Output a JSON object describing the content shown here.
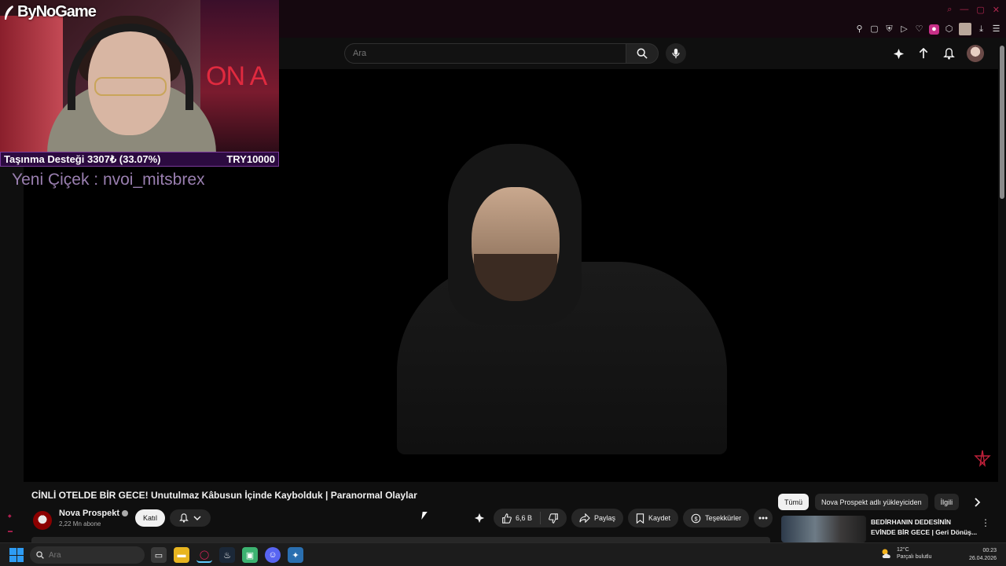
{
  "overlay": {
    "logo_text": "ByNoGame",
    "support_label": "Taşınma Desteği 3307₺ (33.07%)",
    "support_goal": "TRY10000",
    "support_progress_percent": 33.07,
    "new_flower": "Yeni Çiçek : nvoi_mitsbrex",
    "poster_text": "ON A"
  },
  "header": {
    "search_placeholder": "Ara"
  },
  "video": {
    "title": "CİNLİ OTELDE BİR GECE! Unutulmaz Kâbusun İçinde Kaybolduk | Paranormal Olaylar",
    "channel_name": "Nova Prospekt",
    "subscribers": "2,22 Mn abone",
    "join_label": "Katıl",
    "likes": "6,6 B",
    "share_label": "Paylaş",
    "save_label": "Kaydet",
    "thanks_label": "Teşekkürler"
  },
  "sidebar": {
    "chips": [
      {
        "label": "Tümü",
        "active": true
      },
      {
        "label": "Nova Prospekt adlı yükleyiciden",
        "active": false
      },
      {
        "label": "İlgili",
        "active": false
      }
    ],
    "recommendation": {
      "title_line1": "BEDİRHANIN DEDESİNİN",
      "title_line2": "EVİNDE BİR GECE | Geri Dönüş..."
    }
  },
  "taskbar": {
    "search_placeholder": "Ara",
    "weather_temp": "12°C",
    "weather_desc": "Parçalı bulutlu",
    "time": "00:23",
    "date": "26.04.2026"
  },
  "colors": {
    "accent_pink": "#c62f87",
    "support_bar_bg": "#2c0b40",
    "flower_text": "#9a7fb0"
  }
}
